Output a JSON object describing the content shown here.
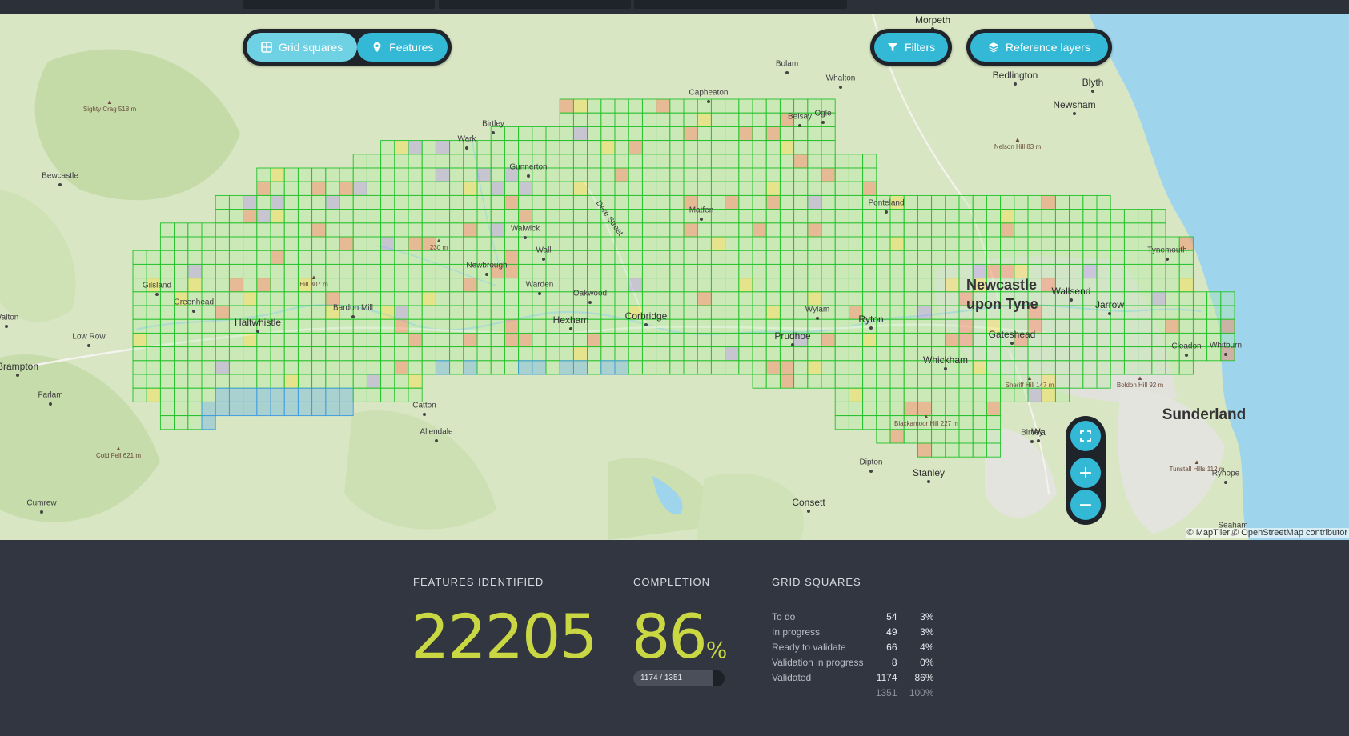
{
  "toolbar": {
    "grid_squares_label": "Grid squares",
    "features_label": "Features",
    "filters_label": "Filters",
    "reference_layers_label": "Reference layers"
  },
  "map": {
    "attribution": "© MapTiler © OpenStreetMap contributor",
    "places": [
      {
        "name": "Morpeth",
        "size": "md"
      },
      {
        "name": "Bolam",
        "size": "sm2"
      },
      {
        "name": "Whalton",
        "size": "sm2"
      },
      {
        "name": "Bedlington",
        "size": "md"
      },
      {
        "name": "Blyth",
        "size": "md"
      },
      {
        "name": "Newsham",
        "size": "md"
      },
      {
        "name": "Capheaton",
        "size": "sm2"
      },
      {
        "name": "Belsay",
        "size": "sm2"
      },
      {
        "name": "Ogle",
        "size": "sm2"
      },
      {
        "name": "Birtley",
        "size": "sm2"
      },
      {
        "name": "Wark",
        "size": "sm2"
      },
      {
        "name": "Gunnerton",
        "size": "sm2"
      },
      {
        "name": "Bewcastle",
        "size": "sm2"
      },
      {
        "name": "Matfen",
        "size": "sm2"
      },
      {
        "name": "Ponteland",
        "size": "sm2"
      },
      {
        "name": "Walwick",
        "size": "sm2"
      },
      {
        "name": "Wall",
        "size": "sm2"
      },
      {
        "name": "Newbrough",
        "size": "sm2"
      },
      {
        "name": "Warden",
        "size": "sm2"
      },
      {
        "name": "Oakwood",
        "size": "sm2"
      },
      {
        "name": "Gilsland",
        "size": "sm2"
      },
      {
        "name": "Greenhead",
        "size": "sm2"
      },
      {
        "name": "Haltwhistle",
        "size": "md"
      },
      {
        "name": "Bardon Mill",
        "size": "sm2"
      },
      {
        "name": "Hexham",
        "size": "md"
      },
      {
        "name": "Corbridge",
        "size": "md"
      },
      {
        "name": "Prudhoe",
        "size": "md"
      },
      {
        "name": "Wylam",
        "size": "sm2"
      },
      {
        "name": "Ryton",
        "size": "md"
      },
      {
        "name": "Newcastle upon Tyne",
        "size": "lg"
      },
      {
        "name": "Wallsend",
        "size": "md"
      },
      {
        "name": "Jarrow",
        "size": "md"
      },
      {
        "name": "Tynemouth",
        "size": "sm2"
      },
      {
        "name": "Gateshead",
        "size": "md"
      },
      {
        "name": "Whickham",
        "size": "md"
      },
      {
        "name": "Cleadon",
        "size": "sm2"
      },
      {
        "name": "Whitburn",
        "size": "sm2"
      },
      {
        "name": "Sunderland",
        "size": "xl"
      },
      {
        "name": "Low Row",
        "size": "sm2"
      },
      {
        "name": "Brampton",
        "size": "md"
      },
      {
        "name": "Farlam",
        "size": "sm2"
      },
      {
        "name": "Catton",
        "size": "sm2"
      },
      {
        "name": "Allendale",
        "size": "sm2"
      },
      {
        "name": "Birtley",
        "size": "sm2"
      },
      {
        "name": "Dipton",
        "size": "sm2"
      },
      {
        "name": "Stanley",
        "size": "md"
      },
      {
        "name": "Consett",
        "size": "md"
      },
      {
        "name": "Cumrew",
        "size": "sm2"
      },
      {
        "name": "Ryhope",
        "size": "sm2"
      },
      {
        "name": "Seaham",
        "size": "sm2"
      },
      {
        "name": "Walton",
        "size": "sm2"
      },
      {
        "name": "Dere Street",
        "size": "sm2"
      },
      {
        "name": "Wa",
        "size": "md"
      }
    ],
    "peaks": [
      "Sighty Crag 518 m",
      "Nelson Hill 83 m",
      "Hill 307 m",
      "230 m",
      "Cold Fell 621 m",
      "Sheriff Hill 147 m",
      "Boldon Hill 92 m",
      "Blackamoor Hill 227 m",
      "Tunstall Hills 112 m"
    ]
  },
  "zoom": {
    "fullscreen_icon": "expand-icon",
    "zoom_in": "+",
    "zoom_out": "−"
  },
  "stats": {
    "features_heading": "FEATURES IDENTIFIED",
    "features_value": "22205",
    "completion_heading": "COMPLETION",
    "completion_value": "86",
    "completion_unit": "%",
    "progress_label": "1174 / 1351",
    "progress_fraction": 0.869,
    "grid_heading": "GRID SQUARES",
    "rows": [
      {
        "label": "To do",
        "count": "54",
        "pct": "3%"
      },
      {
        "label": "In progress",
        "count": "49",
        "pct": "3%"
      },
      {
        "label": "Ready to validate",
        "count": "66",
        "pct": "4%"
      },
      {
        "label": "Validation in progress",
        "count": "8",
        "pct": "0%"
      },
      {
        "label": "Validated",
        "count": "1174",
        "pct": "86%"
      }
    ],
    "total": {
      "count": "1351",
      "pct": "100%"
    }
  },
  "colors": {
    "accent": "#33b9d6",
    "accent_active": "#6fd1e4",
    "stat_value": "#c9d842",
    "panel": "#323640",
    "grid_validated": "#22c12a",
    "grid_todo": "#f0a080",
    "grid_ready": "#f6e04a",
    "grid_progress": "#3d9be0",
    "grid_vip": "#b5a4dd"
  }
}
